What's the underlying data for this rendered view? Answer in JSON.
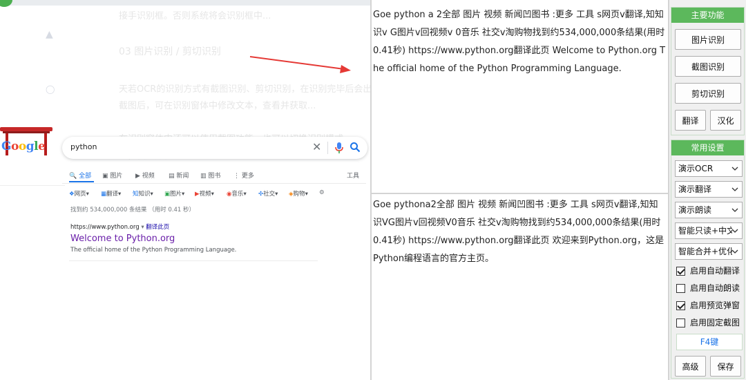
{
  "background_text": {
    "line1": "接手识别框。否则系统将会识别框中...",
    "heading": "03 图片识别 / 剪切识别",
    "para1a": "天若OCR的识别方式有截图识别、剪切识别，在识别完毕后会出现识别结果",
    "para1b": "截图后，可在识别窗体中修改文本，查看并获取...",
    "para2a": "在识别窗体中还可以使用截图功能，也可以切换识别模式...",
    "para2b": "等，使用方便。"
  },
  "google": {
    "doodle_text": "Google",
    "search_query": "python",
    "tabs": [
      "全部",
      "图片",
      "视频",
      "新闻",
      "图书",
      "更多"
    ],
    "tools": "工具",
    "chips": [
      "网页",
      "翻译",
      "知识",
      "图片",
      "视频",
      "音乐",
      "社交",
      "购物"
    ],
    "stats": "找到约 534,000,000 条结果 （用时 0.41 秒）",
    "result_url": "https://www.python.org",
    "result_translate": "翻译此页",
    "result_title": "Welcome to Python.org",
    "result_snippet": "The official home of the Python Programming Language."
  },
  "ocr_result": {
    "text": "Goe python a 2全部 图片 视频 新闻凹图书 :更多 工具 s网页v翻译,知知识v G图片v回视频v 0音乐 社交v淘购物找到约534,000,000条结果(用时0.41秒) https://www.python.org翻译此页 Welcome to Python.org The official home of the Python Programming Language."
  },
  "translation_result": {
    "text": "Goe pythona2全部 图片 视频 新闻凹图书 :更多 工具 s网页v翻译,知知识VG图片v回视频V0音乐 社交v淘购物找到约534,000,000条结果(用时0.41秒) https://www.python.org翻译此页 欢迎来到Python.org，这是Python编程语言的官方主页。"
  },
  "sidebar": {
    "main_header": "主要功能",
    "image_ocr": "图片识别",
    "screenshot_ocr": "截图识别",
    "clipboard_ocr": "剪切识别",
    "translate": "翻译",
    "localize": "汉化",
    "settings_header": "常用设置",
    "dropdowns": [
      "演示OCR",
      "演示翻译",
      "演示朗读",
      "智能只读+中文",
      "智能合并+优化"
    ],
    "checkboxes": [
      {
        "label": "启用自动翻译",
        "checked": true
      },
      {
        "label": "启用自动朗读",
        "checked": false
      },
      {
        "label": "启用预览弹窗",
        "checked": true
      },
      {
        "label": "启用固定截图",
        "checked": false
      }
    ],
    "hotkey": "F4键",
    "advanced": "高级",
    "save": "保存"
  },
  "colors": {
    "accent_green": "#5cb85c",
    "arrow_red": "#e53935",
    "google_blue": "#1a73e8",
    "link_purple": "#681da8"
  }
}
